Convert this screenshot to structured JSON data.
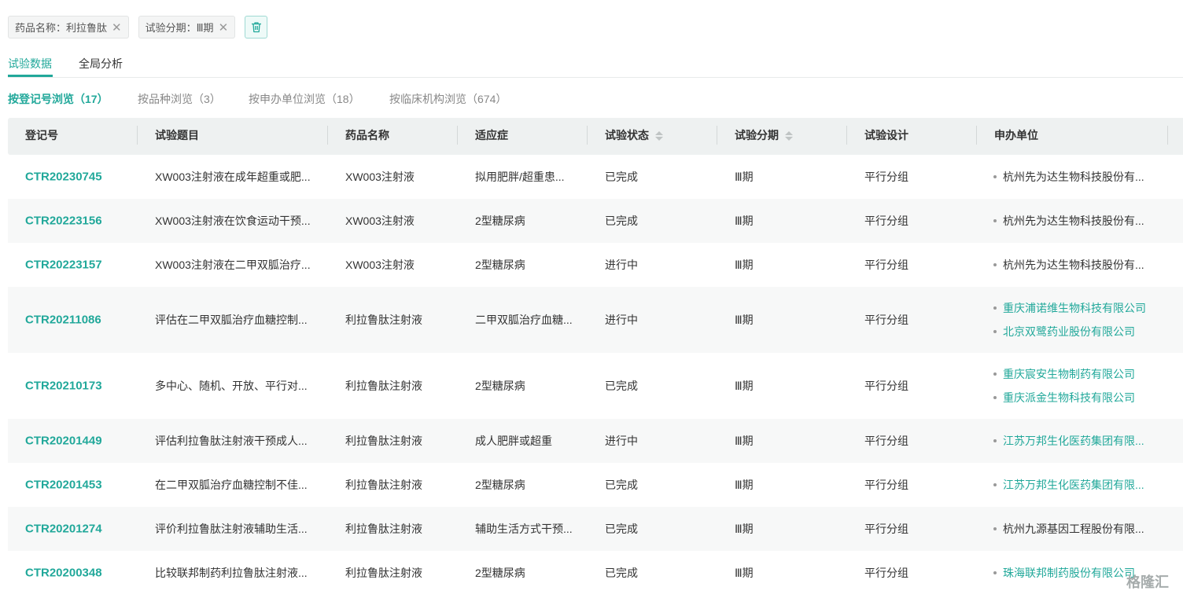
{
  "filters": [
    {
      "label": "药品名称：利拉鲁肽"
    },
    {
      "label": "试验分期：Ⅲ期"
    }
  ],
  "tabs": [
    {
      "label": "试验数据",
      "active": true
    },
    {
      "label": "全局分析",
      "active": false
    }
  ],
  "subtabs": [
    {
      "label": "按登记号浏览（17）",
      "active": true
    },
    {
      "label": "按品种浏览（3）",
      "active": false
    },
    {
      "label": "按申办单位浏览（18）",
      "active": false
    },
    {
      "label": "按临床机构浏览（674）",
      "active": false
    }
  ],
  "table": {
    "headers": {
      "reg_no": "登记号",
      "title": "试验题目",
      "drug": "药品名称",
      "indication": "适应症",
      "status": "试验状态",
      "phase": "试验分期",
      "design": "试验设计",
      "sponsor": "申办单位"
    },
    "rows": [
      {
        "reg_no": "CTR20230745",
        "title": "XW003注射液在成年超重或肥...",
        "drug": "XW003注射液",
        "indication": "拟用肥胖/超重患...",
        "status": "已完成",
        "phase": "Ⅲ期",
        "design": "平行分组",
        "sponsors": [
          {
            "name": "杭州先为达生物科技股份有...",
            "link": false
          }
        ]
      },
      {
        "reg_no": "CTR20223156",
        "title": "XW003注射液在饮食运动干预...",
        "drug": "XW003注射液",
        "indication": "2型糖尿病",
        "status": "已完成",
        "phase": "Ⅲ期",
        "design": "平行分组",
        "sponsors": [
          {
            "name": "杭州先为达生物科技股份有...",
            "link": false
          }
        ]
      },
      {
        "reg_no": "CTR20223157",
        "title": "XW003注射液在二甲双胍治疗...",
        "drug": "XW003注射液",
        "indication": "2型糖尿病",
        "status": "进行中",
        "phase": "Ⅲ期",
        "design": "平行分组",
        "sponsors": [
          {
            "name": "杭州先为达生物科技股份有...",
            "link": false
          }
        ]
      },
      {
        "reg_no": "CTR20211086",
        "title": "评估在二甲双胍治疗血糖控制...",
        "drug": "利拉鲁肽注射液",
        "indication": "二甲双胍治疗血糖...",
        "status": "进行中",
        "phase": "Ⅲ期",
        "design": "平行分组",
        "sponsors": [
          {
            "name": "重庆浦诺维生物科技有限公司",
            "link": true
          },
          {
            "name": "北京双鹭药业股份有限公司",
            "link": true
          }
        ]
      },
      {
        "reg_no": "CTR20210173",
        "title": "多中心、随机、开放、平行对...",
        "drug": "利拉鲁肽注射液",
        "indication": "2型糖尿病",
        "status": "已完成",
        "phase": "Ⅲ期",
        "design": "平行分组",
        "sponsors": [
          {
            "name": "重庆宸安生物制药有限公司",
            "link": true
          },
          {
            "name": "重庆派金生物科技有限公司",
            "link": true
          }
        ]
      },
      {
        "reg_no": "CTR20201449",
        "title": "评估利拉鲁肽注射液干预成人...",
        "drug": "利拉鲁肽注射液",
        "indication": "成人肥胖或超重",
        "status": "进行中",
        "phase": "Ⅲ期",
        "design": "平行分组",
        "sponsors": [
          {
            "name": "江苏万邦生化医药集团有限...",
            "link": true
          }
        ]
      },
      {
        "reg_no": "CTR20201453",
        "title": "在二甲双胍治疗血糖控制不佳...",
        "drug": "利拉鲁肽注射液",
        "indication": "2型糖尿病",
        "status": "已完成",
        "phase": "Ⅲ期",
        "design": "平行分组",
        "sponsors": [
          {
            "name": "江苏万邦生化医药集团有限...",
            "link": true
          }
        ]
      },
      {
        "reg_no": "CTR20201274",
        "title": "评价利拉鲁肽注射液辅助生活...",
        "drug": "利拉鲁肽注射液",
        "indication": "辅助生活方式干预...",
        "status": "已完成",
        "phase": "Ⅲ期",
        "design": "平行分组",
        "sponsors": [
          {
            "name": "杭州九源基因工程股份有限...",
            "link": false
          }
        ]
      },
      {
        "reg_no": "CTR20200348",
        "title": "比较联邦制药利拉鲁肽注射液...",
        "drug": "利拉鲁肽注射液",
        "indication": "2型糖尿病",
        "status": "已完成",
        "phase": "Ⅲ期",
        "design": "平行分组",
        "sponsors": [
          {
            "name": "珠海联邦制药股份有限公司",
            "link": true
          }
        ]
      }
    ]
  },
  "watermark": "格隆汇",
  "colors": {
    "accent": "#21a89a",
    "header_bg": "#eef1f1",
    "row_alt": "#f7f8f8"
  }
}
